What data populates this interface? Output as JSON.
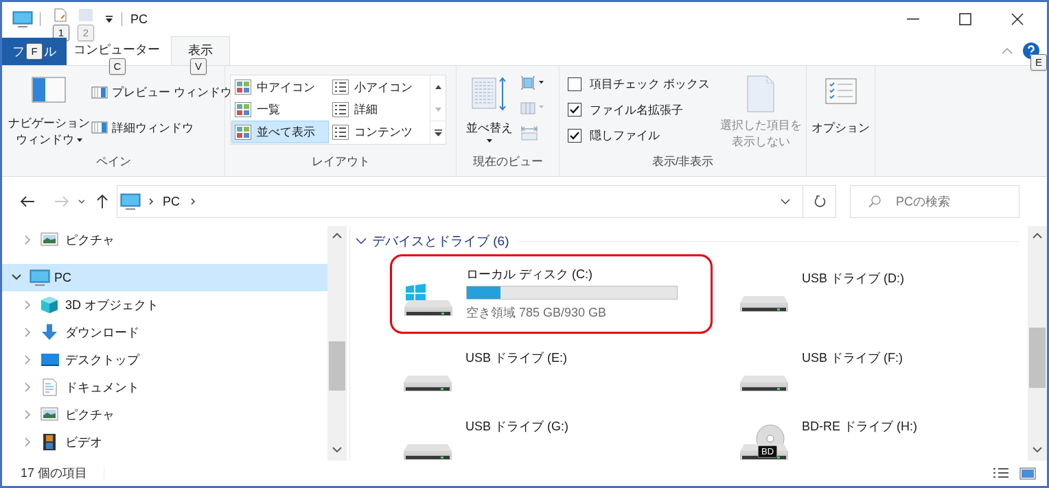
{
  "window": {
    "title": "PC",
    "quick_access_keytips": [
      "1",
      "2"
    ]
  },
  "tabs": [
    {
      "visible_parts": [
        "フ",
        "ル"
      ],
      "kind": "file",
      "selected": false,
      "keytip": "F"
    },
    {
      "label": "コンピューター",
      "kind": "tab",
      "selected": false,
      "keytip": "C"
    },
    {
      "label": "表示",
      "kind": "tab",
      "selected": true,
      "keytip": "V"
    }
  ],
  "help_keytip": "E",
  "ribbon": {
    "pane": {
      "label": "ペイン",
      "navigation_pane": [
        "ナビゲーション",
        "ウィンドウ"
      ],
      "buttons": [
        "プレビュー ウィンドウ",
        "詳細ウィンドウ"
      ]
    },
    "layout": {
      "label": "レイアウト",
      "options": [
        {
          "label": "中アイコン",
          "selected": false
        },
        {
          "label": "小アイコン",
          "selected": false
        },
        {
          "label": "一覧",
          "selected": false
        },
        {
          "label": "詳細",
          "selected": false
        },
        {
          "label": "並べて表示",
          "selected": true
        },
        {
          "label": "コンテンツ",
          "selected": false
        }
      ]
    },
    "current_view": {
      "label": "現在のビュー",
      "sort": "並べ替え"
    },
    "show_hide": {
      "label": "表示/非表示",
      "checkboxes": [
        {
          "label": "項目チェック ボックス",
          "checked": false
        },
        {
          "label": "ファイル名拡張子",
          "checked": true
        },
        {
          "label": "隠しファイル",
          "checked": true
        }
      ],
      "hide_selected": {
        "lines": [
          "選択した項目を",
          "表示しない"
        ],
        "disabled": true
      }
    },
    "options": {
      "label": "オプション"
    }
  },
  "history": {
    "forward": {
      "disabled": true
    }
  },
  "address_bar": {
    "path": [
      "PC"
    ]
  },
  "search": {
    "placeholder": "PCの検索"
  },
  "navigation": [
    {
      "label": "ピクチャ",
      "kind": "pictures",
      "expanded": false,
      "selected": false
    },
    {
      "label": "PC",
      "kind": "pc",
      "expanded": true,
      "selected": true,
      "children": [
        {
          "label": "3D オブジェクト",
          "kind": "objects3d",
          "expanded": false,
          "selected": false
        },
        {
          "label": "ダウンロード",
          "kind": "downloads",
          "expanded": false,
          "selected": false
        },
        {
          "label": "デスクトップ",
          "kind": "desktop",
          "expanded": false,
          "selected": false
        },
        {
          "label": "ドキュメント",
          "kind": "documents",
          "expanded": false,
          "selected": false
        },
        {
          "label": "ピクチャ",
          "kind": "pictures",
          "expanded": false,
          "selected": false
        },
        {
          "label": "ビデオ",
          "kind": "videos",
          "expanded": false,
          "selected": false
        }
      ]
    }
  ],
  "section": {
    "title": "デバイスとドライブ (6)",
    "expanded": true
  },
  "drives": [
    {
      "name": "ローカル ディスク (C:)",
      "kind": "system",
      "level": 0.16,
      "free": "空き領域 785 GB/930 GB",
      "highlighted": true
    },
    {
      "name": "USB ドライブ (D:)",
      "kind": "usb",
      "highlighted": false
    },
    {
      "name": "USB ドライブ (E:)",
      "kind": "usb",
      "highlighted": false
    },
    {
      "name": "USB ドライブ (F:)",
      "kind": "usb",
      "highlighted": false
    },
    {
      "name": "USB ドライブ (G:)",
      "kind": "usb",
      "highlighted": false
    },
    {
      "name": "BD-RE ドライブ (H:)",
      "kind": "optical",
      "icon_label": "BD",
      "highlighted": false
    }
  ],
  "status_bar": {
    "item_count": "17 個の項目"
  }
}
